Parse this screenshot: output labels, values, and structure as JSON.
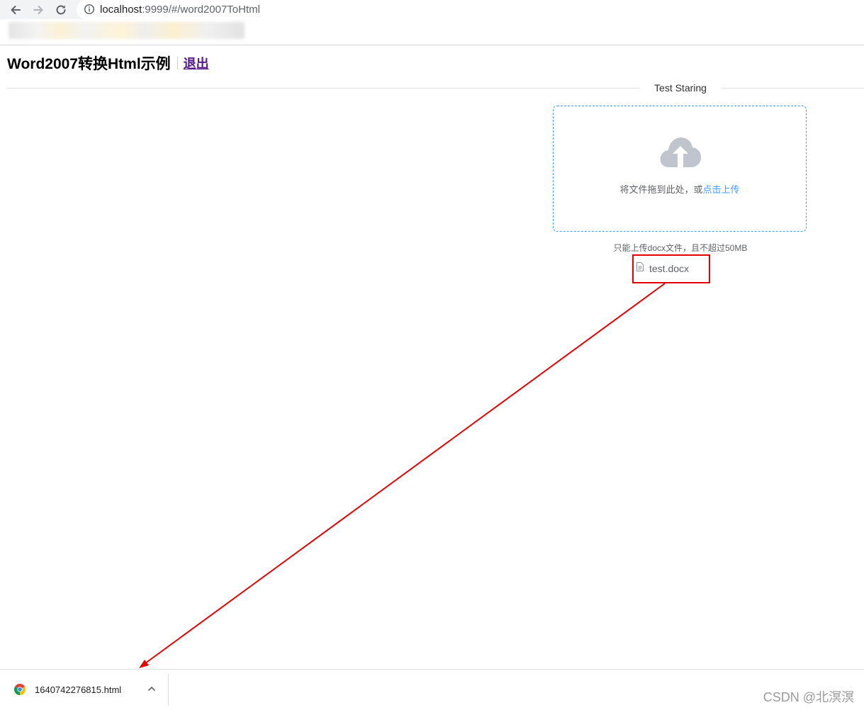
{
  "browser": {
    "url_host": "localhost",
    "url_rest": ":9999/#/word2007ToHtml",
    "back_icon": "back-arrow-icon",
    "forward_icon": "forward-arrow-icon",
    "reload_icon": "reload-icon",
    "info_icon": "info-icon"
  },
  "header": {
    "title": "Word2007转换Html示例",
    "logout_label": "退出"
  },
  "divider": {
    "text": "Test Staring"
  },
  "upload": {
    "icon": "upload-cloud-icon",
    "drag_text": "将文件拖到此处，或",
    "click_text": "点击上传",
    "tip": "只能上传docx文件，且不超过50MB",
    "files": [
      {
        "name": "test.docx",
        "icon": "document-icon"
      }
    ]
  },
  "downloads": {
    "items": [
      {
        "filename": "1640742276815.html",
        "icon": "chrome-icon",
        "menu_icon": "chevron-up-icon"
      }
    ]
  },
  "watermark": "CSDN @北溟溟",
  "colors": {
    "accent": "#409eff",
    "annotation": "#e60000",
    "visited_link": "#551a8b"
  }
}
